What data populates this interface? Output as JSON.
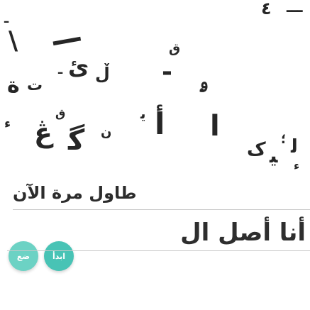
{
  "game": {
    "letters": [
      "ـــ",
      "٤",
      "ـ",
      "\\",
      "—",
      "ق",
      "-",
      "ـ",
      "ئ",
      "ڵ",
      "ة",
      "ت",
      "ۄ",
      "ق",
      "ء",
      "ڠ",
      "ﮔ",
      "ن",
      "ﯾ",
      "أ",
      "ﺍ",
      "ﮎ",
      "ﯿ",
      "؛",
      "ﻟ",
      "ء"
    ]
  },
  "prompt": "طاول مرة الآن",
  "answer": {
    "text": "أنا أصل ال",
    "badges": [
      {
        "label": "ضع",
        "color": "#6cd2c4"
      },
      {
        "label": "ابدأ",
        "color": "#48c3b5"
      }
    ]
  },
  "colors": {
    "text": "#262626",
    "accent": "#6cd2c4",
    "primary": "#48c3b5",
    "rule": "#c9c9c9",
    "background": "#ffffff"
  }
}
